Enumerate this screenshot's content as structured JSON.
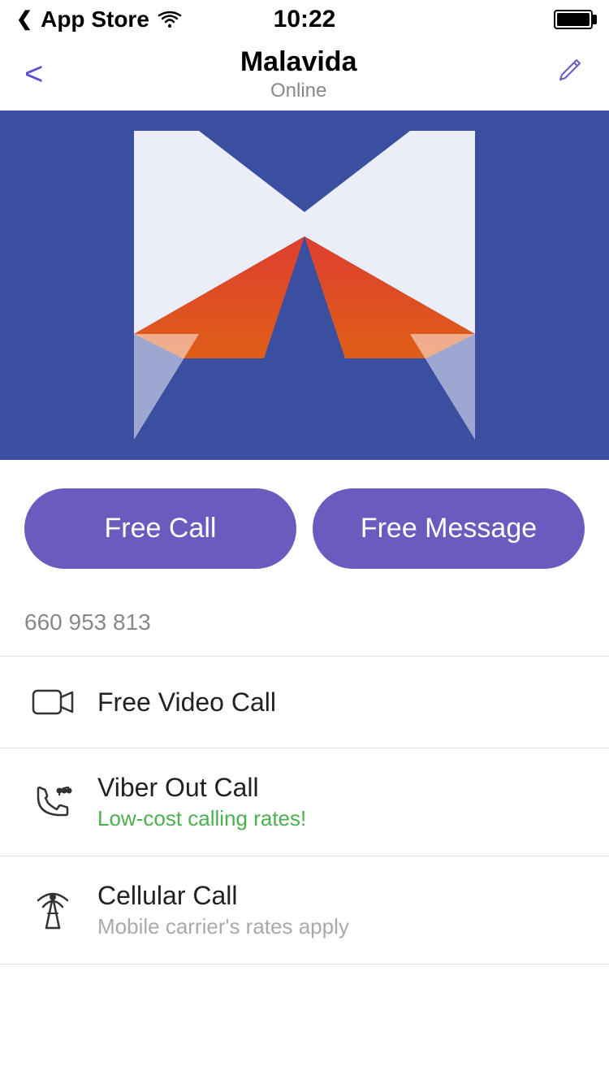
{
  "statusBar": {
    "appStore": "App Store",
    "time": "10:22",
    "wifiSymbol": "📶"
  },
  "navBar": {
    "title": "Malavida",
    "subtitle": "Online",
    "backLabel": "<",
    "editLabel": "✏"
  },
  "actionButtons": {
    "freeCall": "Free Call",
    "freeMessage": "Free Message"
  },
  "phone": {
    "number": "660 953 813"
  },
  "options": [
    {
      "id": "video-call",
      "title": "Free Video Call",
      "subtitle": "",
      "subtitleType": "none"
    },
    {
      "id": "viber-out",
      "title": "Viber Out Call",
      "subtitle": "Low-cost calling rates!",
      "subtitleType": "green"
    },
    {
      "id": "cellular",
      "title": "Cellular Call",
      "subtitle": "Mobile carrier's rates apply",
      "subtitleType": "gray"
    }
  ],
  "colors": {
    "accent": "#6b5bbf",
    "green": "#4caf50",
    "gray": "#aaaaaa"
  }
}
